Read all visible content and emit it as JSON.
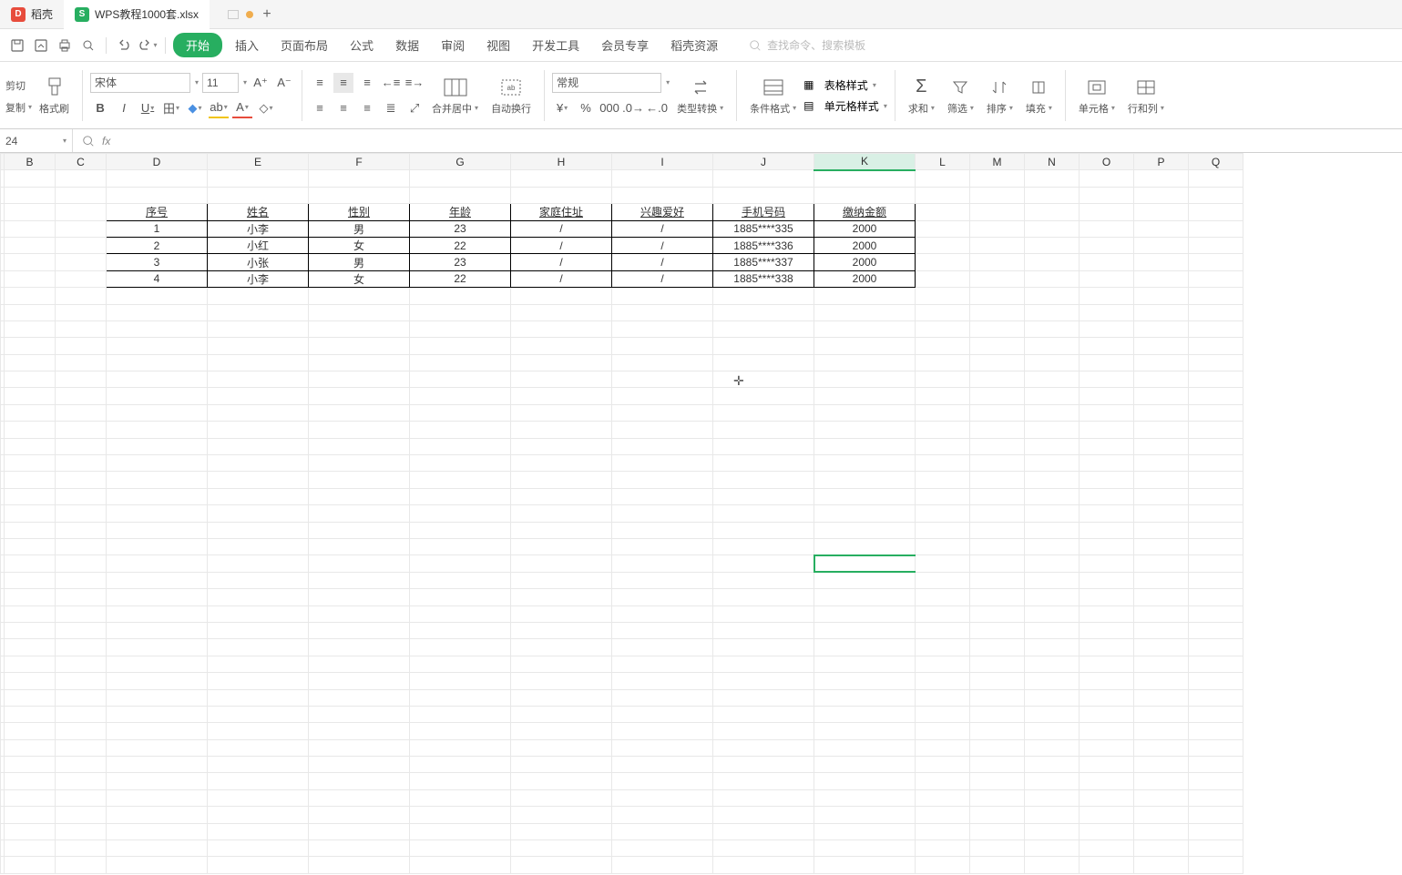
{
  "titlebar": {
    "tab1": "稻壳",
    "tab2": "WPS教程1000套.xlsx",
    "plus": "+"
  },
  "menu": {
    "tabs": [
      "开始",
      "插入",
      "页面布局",
      "公式",
      "数据",
      "审阅",
      "视图",
      "开发工具",
      "会员专享",
      "稻壳资源"
    ],
    "search_placeholder": "查找命令、搜索模板"
  },
  "ribbon": {
    "cut": "剪切",
    "copy": "复制",
    "painter": "格式刷",
    "font_name": "宋体",
    "font_size": "11",
    "merge": "合并居中",
    "wrap": "自动换行",
    "number_format": "常规",
    "type_convert": "类型转换",
    "cond_format": "条件格式",
    "table_style": "表格样式",
    "cell_style": "单元格样式",
    "sum": "求和",
    "filter": "筛选",
    "sort": "排序",
    "fill": "填充",
    "cell": "单元格",
    "rowcol": "行和列"
  },
  "formula": {
    "name_box": "24",
    "fx": "fx"
  },
  "columns": [
    "B",
    "C",
    "D",
    "E",
    "F",
    "G",
    "H",
    "I",
    "J",
    "K",
    "L",
    "M",
    "N",
    "O",
    "P",
    "Q"
  ],
  "table": {
    "headers": [
      "序号",
      "姓名",
      "性别",
      "年龄",
      "家庭住址",
      "兴趣爱好",
      "手机号码",
      "缴纳金额"
    ],
    "rows": [
      [
        "1",
        "小李",
        "男",
        "23",
        "/",
        "/",
        "1885****335",
        "2000"
      ],
      [
        "2",
        "小红",
        "女",
        "22",
        "/",
        "/",
        "1885****336",
        "2000"
      ],
      [
        "3",
        "小张",
        "男",
        "23",
        "/",
        "/",
        "1885****337",
        "2000"
      ],
      [
        "4",
        "小李",
        "女",
        "22",
        "/",
        "/",
        "1885****338",
        "2000"
      ]
    ]
  }
}
